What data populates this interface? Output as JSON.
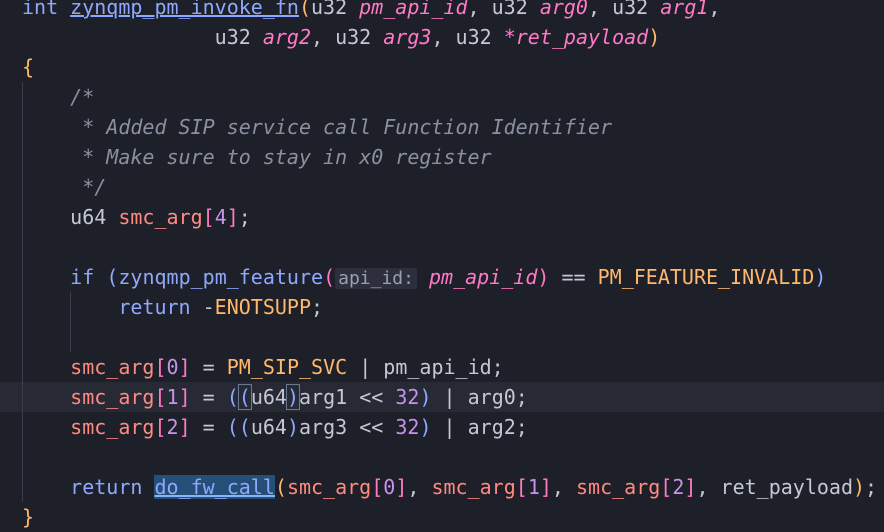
{
  "colors": {
    "background": "#1e2029",
    "current_line": "#272a35",
    "keyword": "#8fa8ff",
    "function": "#8fa8ff",
    "type": "#c4c8d4",
    "param": "#ff79c6",
    "variable": "#ff8a80",
    "macro": "#ffb86c",
    "number": "#c792ea",
    "operator": "#c4c8d4",
    "comment": "#8b90a0",
    "punct": "#c4c8d4",
    "paren": "#8fa8ff",
    "bracket": "#ff79c6"
  },
  "lines": [
    {
      "cur": false,
      "tokens": [
        {
          "t": "int",
          "c": "keyword"
        },
        {
          "t": " ",
          "c": "punct"
        },
        {
          "t": "zynqmp_pm_invoke_fn",
          "c": "function",
          "u": true
        },
        {
          "t": "(",
          "c": "macro"
        },
        {
          "t": "u32",
          "c": "type"
        },
        {
          "t": " ",
          "c": "punct"
        },
        {
          "t": "pm_api_id",
          "c": "param",
          "i": true
        },
        {
          "t": ", ",
          "c": "punct"
        },
        {
          "t": "u32",
          "c": "type"
        },
        {
          "t": " ",
          "c": "punct"
        },
        {
          "t": "arg0",
          "c": "param",
          "i": true
        },
        {
          "t": ", ",
          "c": "punct"
        },
        {
          "t": "u32",
          "c": "type"
        },
        {
          "t": " ",
          "c": "punct"
        },
        {
          "t": "arg1",
          "c": "param",
          "i": true
        },
        {
          "t": ",",
          "c": "punct"
        }
      ]
    },
    {
      "cur": false,
      "tokens": [
        {
          "t": "                ",
          "c": "punct"
        },
        {
          "t": "u32",
          "c": "type"
        },
        {
          "t": " ",
          "c": "punct"
        },
        {
          "t": "arg2",
          "c": "param",
          "i": true
        },
        {
          "t": ", ",
          "c": "punct"
        },
        {
          "t": "u32",
          "c": "type"
        },
        {
          "t": " ",
          "c": "punct"
        },
        {
          "t": "arg3",
          "c": "param",
          "i": true
        },
        {
          "t": ", ",
          "c": "punct"
        },
        {
          "t": "u32",
          "c": "type"
        },
        {
          "t": " ",
          "c": "punct"
        },
        {
          "t": "*",
          "c": "param"
        },
        {
          "t": "ret_payload",
          "c": "param",
          "i": true
        },
        {
          "t": ")",
          "c": "macro"
        }
      ]
    },
    {
      "cur": false,
      "tokens": [
        {
          "t": "{",
          "c": "macro"
        }
      ]
    },
    {
      "cur": false,
      "tokens": [
        {
          "t": "    /*",
          "c": "comment",
          "i": true
        }
      ]
    },
    {
      "cur": false,
      "tokens": [
        {
          "t": "     * Added SIP service call Function Identifier",
          "c": "comment",
          "i": true
        }
      ]
    },
    {
      "cur": false,
      "tokens": [
        {
          "t": "     * Make sure to stay in x0 register",
          "c": "comment",
          "i": true
        }
      ]
    },
    {
      "cur": false,
      "tokens": [
        {
          "t": "     */",
          "c": "comment",
          "i": true
        }
      ]
    },
    {
      "cur": false,
      "tokens": [
        {
          "t": "    ",
          "c": "punct"
        },
        {
          "t": "u64",
          "c": "type"
        },
        {
          "t": " ",
          "c": "punct"
        },
        {
          "t": "smc_arg",
          "c": "variable"
        },
        {
          "t": "[",
          "c": "bracket"
        },
        {
          "t": "4",
          "c": "number"
        },
        {
          "t": "]",
          "c": "bracket"
        },
        {
          "t": ";",
          "c": "punct"
        }
      ]
    },
    {
      "cur": false,
      "tokens": []
    },
    {
      "cur": false,
      "tokens": [
        {
          "t": "    ",
          "c": "punct"
        },
        {
          "t": "if",
          "c": "keyword"
        },
        {
          "t": " ",
          "c": "punct"
        },
        {
          "t": "(",
          "c": "paren"
        },
        {
          "t": "zynqmp_pm_feature",
          "c": "function"
        },
        {
          "t": "(",
          "c": "bracket"
        },
        {
          "t": "api_id:",
          "c": "inlay"
        },
        {
          "t": " ",
          "c": "punct"
        },
        {
          "t": "pm_api_id",
          "c": "param",
          "i": true
        },
        {
          "t": ")",
          "c": "bracket"
        },
        {
          "t": " == ",
          "c": "operator"
        },
        {
          "t": "PM_FEATURE_INVALID",
          "c": "macro"
        },
        {
          "t": ")",
          "c": "paren"
        }
      ]
    },
    {
      "cur": false,
      "tokens": [
        {
          "t": "        ",
          "c": "punct"
        },
        {
          "t": "return",
          "c": "keyword"
        },
        {
          "t": " ",
          "c": "punct"
        },
        {
          "t": "-",
          "c": "operator"
        },
        {
          "t": "ENOTSUPP",
          "c": "macro"
        },
        {
          "t": ";",
          "c": "punct"
        }
      ]
    },
    {
      "cur": false,
      "tokens": []
    },
    {
      "cur": false,
      "tokens": [
        {
          "t": "    ",
          "c": "punct"
        },
        {
          "t": "smc_arg",
          "c": "variable"
        },
        {
          "t": "[",
          "c": "bracket"
        },
        {
          "t": "0",
          "c": "number"
        },
        {
          "t": "]",
          "c": "bracket"
        },
        {
          "t": " = ",
          "c": "operator"
        },
        {
          "t": "PM_SIP_SVC",
          "c": "macro"
        },
        {
          "t": " | ",
          "c": "operator"
        },
        {
          "t": "pm_api_id",
          "c": "type"
        },
        {
          "t": ";",
          "c": "punct"
        }
      ]
    },
    {
      "cur": true,
      "tokens": [
        {
          "t": "    ",
          "c": "punct"
        },
        {
          "t": "smc_arg",
          "c": "variable"
        },
        {
          "t": "[",
          "c": "bracket"
        },
        {
          "t": "1",
          "c": "number"
        },
        {
          "t": "]",
          "c": "bracket"
        },
        {
          "t": " = ",
          "c": "operator"
        },
        {
          "t": "(",
          "c": "paren"
        },
        {
          "t": "(",
          "c": "paren",
          "m": true
        },
        {
          "t": "u64",
          "c": "type"
        },
        {
          "t": ")",
          "c": "paren",
          "m": true
        },
        {
          "t": "arg1",
          "c": "type"
        },
        {
          "t": " << ",
          "c": "operator"
        },
        {
          "t": "32",
          "c": "number"
        },
        {
          "t": ")",
          "c": "paren"
        },
        {
          "t": " | ",
          "c": "operator"
        },
        {
          "t": "arg0",
          "c": "type"
        },
        {
          "t": ";",
          "c": "punct"
        }
      ]
    },
    {
      "cur": false,
      "tokens": [
        {
          "t": "    ",
          "c": "punct"
        },
        {
          "t": "smc_arg",
          "c": "variable"
        },
        {
          "t": "[",
          "c": "bracket"
        },
        {
          "t": "2",
          "c": "number"
        },
        {
          "t": "]",
          "c": "bracket"
        },
        {
          "t": " = ",
          "c": "operator"
        },
        {
          "t": "((",
          "c": "paren"
        },
        {
          "t": "u64",
          "c": "type"
        },
        {
          "t": ")",
          "c": "paren"
        },
        {
          "t": "arg3",
          "c": "type"
        },
        {
          "t": " << ",
          "c": "operator"
        },
        {
          "t": "32",
          "c": "number"
        },
        {
          "t": ")",
          "c": "paren"
        },
        {
          "t": " | ",
          "c": "operator"
        },
        {
          "t": "arg2",
          "c": "type"
        },
        {
          "t": ";",
          "c": "punct"
        }
      ]
    },
    {
      "cur": false,
      "tokens": []
    },
    {
      "cur": false,
      "tokens": [
        {
          "t": "    ",
          "c": "punct"
        },
        {
          "t": "return",
          "c": "keyword"
        },
        {
          "t": " ",
          "c": "punct"
        },
        {
          "t": "do_fw_call",
          "c": "function",
          "h": true
        },
        {
          "t": "(",
          "c": "macro"
        },
        {
          "t": "smc_arg",
          "c": "variable"
        },
        {
          "t": "[",
          "c": "bracket"
        },
        {
          "t": "0",
          "c": "number"
        },
        {
          "t": "]",
          "c": "bracket"
        },
        {
          "t": ", ",
          "c": "punct"
        },
        {
          "t": "smc_arg",
          "c": "variable"
        },
        {
          "t": "[",
          "c": "bracket"
        },
        {
          "t": "1",
          "c": "number"
        },
        {
          "t": "]",
          "c": "bracket"
        },
        {
          "t": ", ",
          "c": "punct"
        },
        {
          "t": "smc_arg",
          "c": "variable"
        },
        {
          "t": "[",
          "c": "bracket"
        },
        {
          "t": "2",
          "c": "number"
        },
        {
          "t": "]",
          "c": "bracket"
        },
        {
          "t": ", ",
          "c": "punct"
        },
        {
          "t": "ret_payload",
          "c": "type"
        },
        {
          "t": ")",
          "c": "macro"
        },
        {
          "t": ";",
          "c": "punct"
        }
      ]
    },
    {
      "cur": false,
      "tokens": [
        {
          "t": "}",
          "c": "macro"
        }
      ]
    }
  ]
}
